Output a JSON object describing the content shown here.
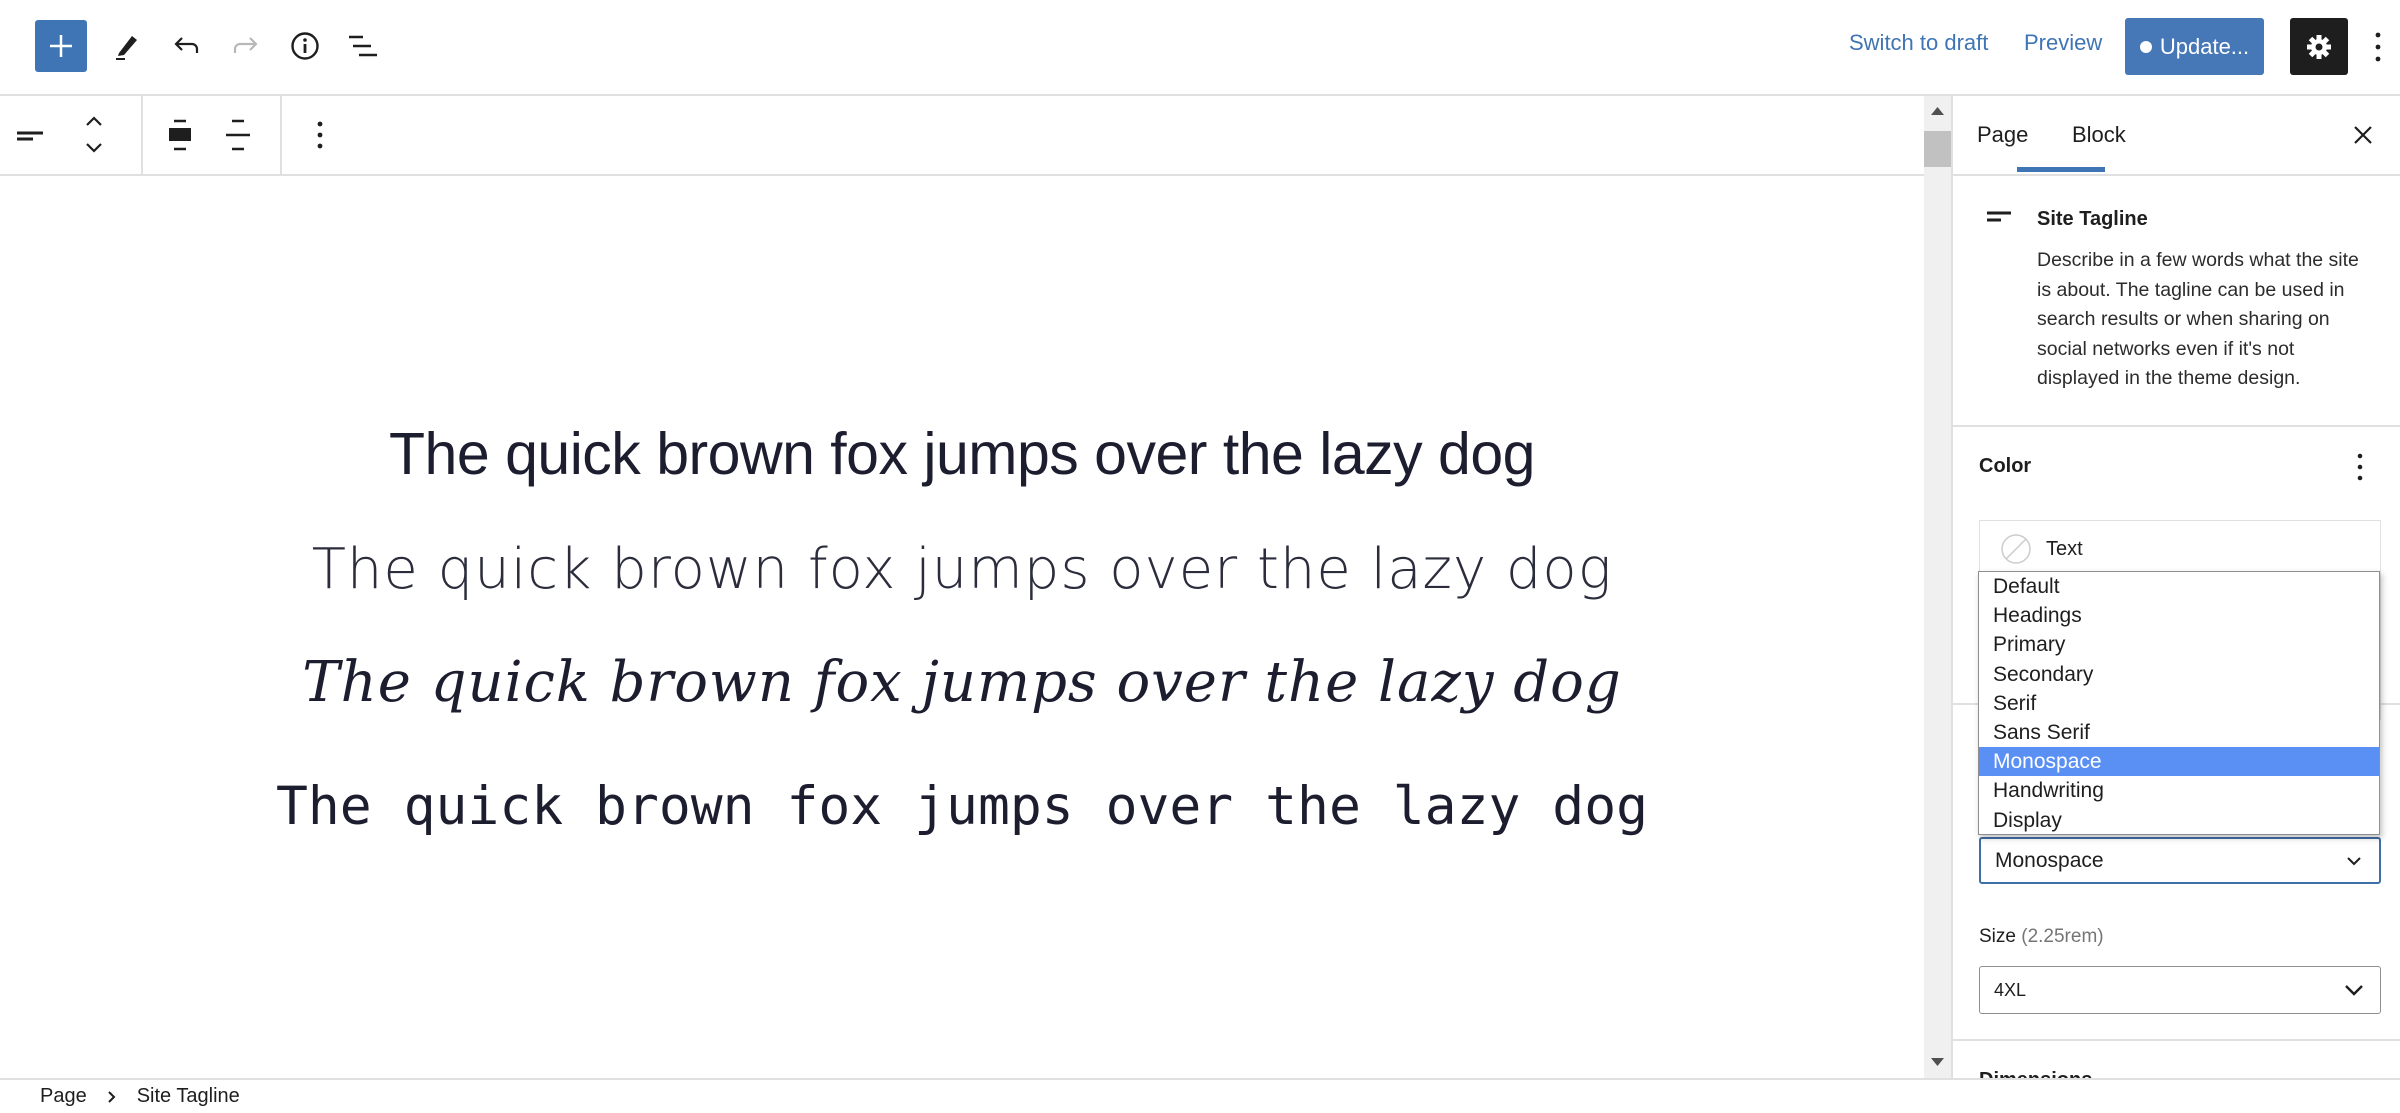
{
  "header": {
    "icons": [
      "plus-icon",
      "pencil-icon",
      "undo-icon",
      "redo-icon",
      "info-icon",
      "list-view-icon",
      "gear-icon",
      "more-vertical-icon"
    ],
    "switch_to_draft": "Switch to draft",
    "preview": "Preview",
    "update": "Update...",
    "accent": "#3f74b5"
  },
  "toolbar": {
    "icons": [
      "site-tagline-icon",
      "move-up-icon",
      "move-down-icon",
      "align-icon",
      "justify-icon",
      "more-options-icon"
    ]
  },
  "content": {
    "lines": [
      "The quick brown fox jumps over the lazy dog",
      "The quick brown fox jumps over the lazy dog",
      "The quick brown fox jumps over the lazy dog",
      "The quick brown fox jumps over the lazy dog"
    ]
  },
  "sidebar": {
    "tabs": [
      {
        "label": "Page"
      },
      {
        "label": "Block",
        "active": true
      }
    ],
    "block_title": "Site Tagline",
    "block_description": "Describe in a few words what the site is about. The tagline can be used in search results or when sharing on social networks even if it's not displayed in the theme design.",
    "color_heading": "Color",
    "color_text_label": "Text",
    "font_options": [
      "Default",
      "Headings",
      "Primary",
      "Secondary",
      "Serif",
      "Sans Serif",
      "Monospace",
      "Handwriting",
      "Display"
    ],
    "font_selected": "Monospace",
    "size_label": "Size",
    "size_value": "(2.25rem)",
    "size_selected": "4XL",
    "dimensions_heading": "Dimensions"
  },
  "breadcrumb": {
    "items": [
      "Page",
      "Site Tagline"
    ]
  }
}
